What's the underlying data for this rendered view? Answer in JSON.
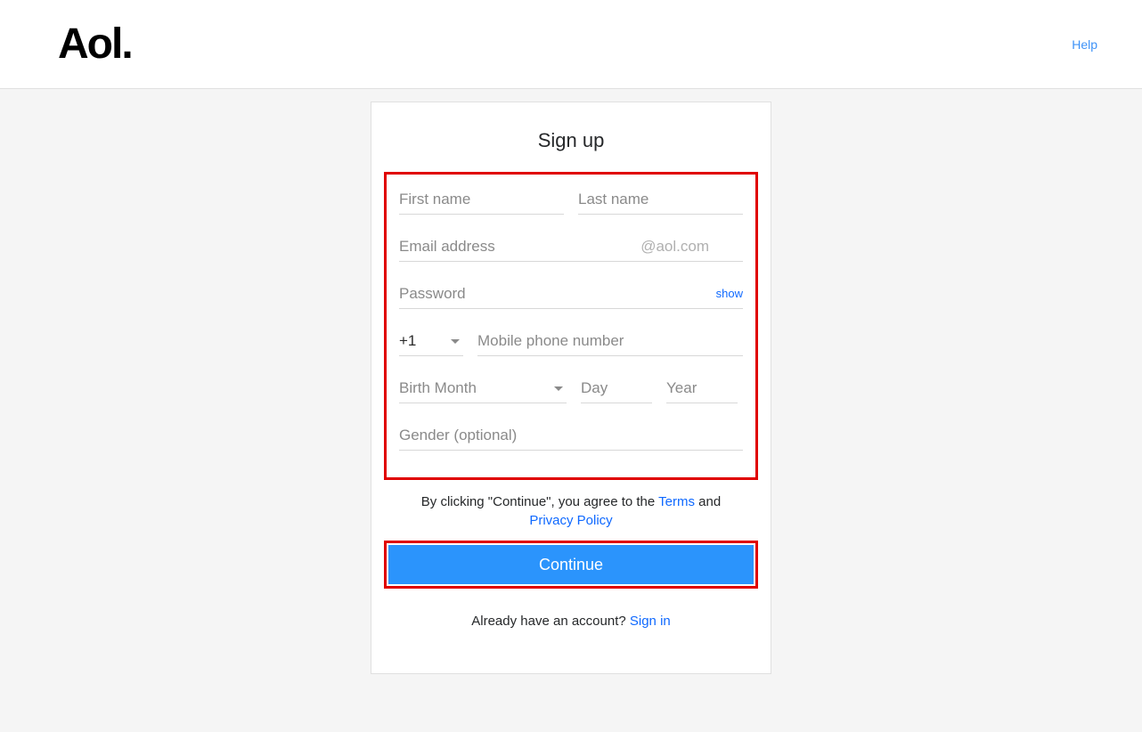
{
  "header": {
    "logo_text": "Aol.",
    "help_label": "Help"
  },
  "form": {
    "title": "Sign up",
    "first_name_placeholder": "First name",
    "last_name_placeholder": "Last name",
    "email_placeholder": "Email address",
    "email_suffix": "@aol.com",
    "password_placeholder": "Password",
    "show_label": "show",
    "country_code": "+1",
    "phone_placeholder": "Mobile phone number",
    "birth_month_placeholder": "Birth Month",
    "birth_day_placeholder": "Day",
    "birth_year_placeholder": "Year",
    "gender_placeholder": "Gender (optional)"
  },
  "legal": {
    "prefix": "By clicking \"Continue\", you agree to the ",
    "terms_label": "Terms",
    "middle": " and ",
    "privacy_label": "Privacy Policy"
  },
  "actions": {
    "continue_label": "Continue",
    "signin_prefix": "Already have an account? ",
    "signin_label": "Sign in"
  }
}
